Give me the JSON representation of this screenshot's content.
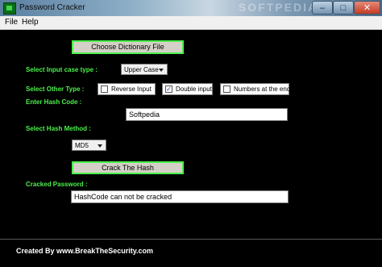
{
  "window": {
    "title": "Password Cracker",
    "watermark": "SOFTPEDIA",
    "controls": {
      "minimize": "–",
      "maximize": "□",
      "close": "✕"
    }
  },
  "menu": {
    "file": "File",
    "help": "Help"
  },
  "dictionary_button": "Choose Dictionary File",
  "input_case": {
    "label": "Select Input case type :",
    "value": "Upper Case"
  },
  "other_type": {
    "label": "Select Other Type :",
    "options": [
      {
        "label": "Reverse Input",
        "checked": false
      },
      {
        "label": "Double input",
        "checked": true
      },
      {
        "label": "Numbers at the end",
        "checked": false
      }
    ]
  },
  "hash_code": {
    "label": "Enter Hash Code :",
    "value": "Softpedia"
  },
  "hash_method": {
    "label": "Select Hash Method :",
    "value": "MD5"
  },
  "crack_button": "Crack The Hash",
  "cracked": {
    "label": "Cracked Password :",
    "value": "HashCode can not be cracked"
  },
  "status": "Created By www.BreakTheSecurity.com",
  "colors": {
    "accent_green": "#4cf04c",
    "background": "#000000"
  },
  "icons": {
    "app": "app-icon",
    "check": "check-icon",
    "dropdown": "chevron-down-icon"
  }
}
